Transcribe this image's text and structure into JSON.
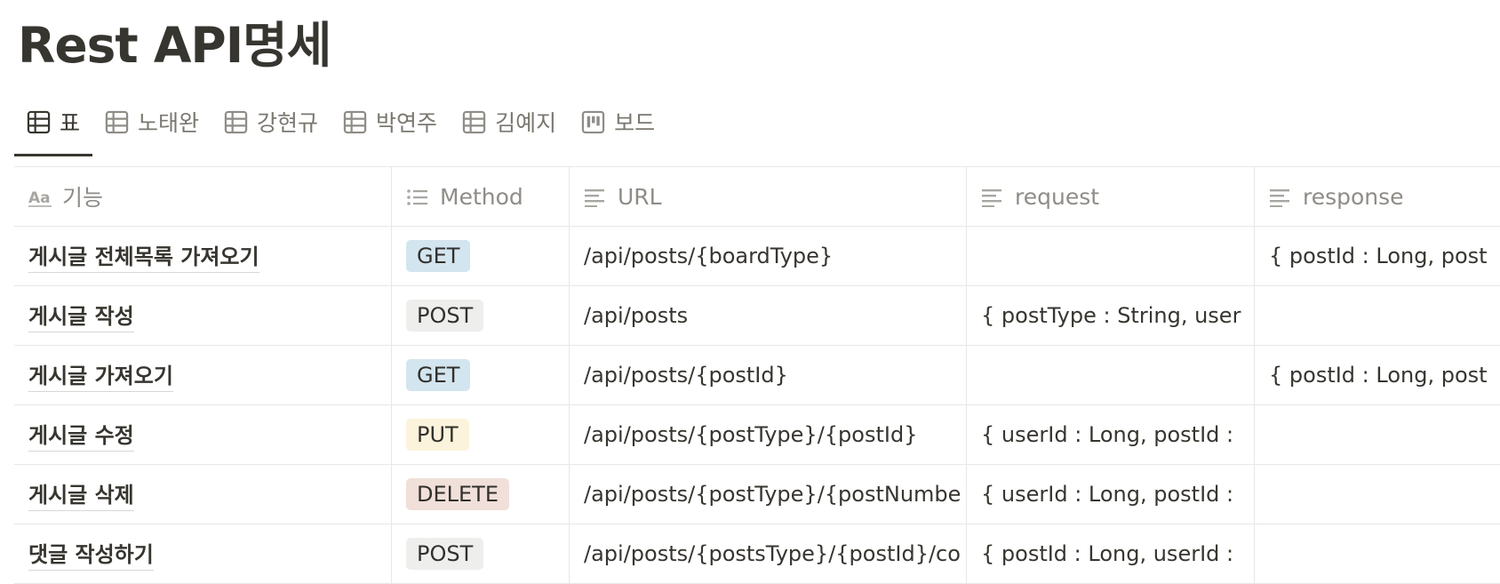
{
  "page": {
    "title": "Rest API명세"
  },
  "tabs": [
    {
      "label": "표",
      "icon": "table-icon",
      "active": true
    },
    {
      "label": "노태완",
      "icon": "table-icon",
      "active": false
    },
    {
      "label": "강현규",
      "icon": "table-icon",
      "active": false
    },
    {
      "label": "박연주",
      "icon": "table-icon",
      "active": false
    },
    {
      "label": "김예지",
      "icon": "table-icon",
      "active": false
    },
    {
      "label": "보드",
      "icon": "board-icon",
      "active": false
    }
  ],
  "table": {
    "columns": [
      {
        "label": "기능",
        "icon": "title-property-icon"
      },
      {
        "label": "Method",
        "icon": "list-property-icon"
      },
      {
        "label": "URL",
        "icon": "text-property-icon"
      },
      {
        "label": "request",
        "icon": "text-property-icon"
      },
      {
        "label": "response",
        "icon": "text-property-icon"
      }
    ],
    "rows": [
      {
        "name": "게시글 전체목록 가져오기",
        "method": "GET",
        "url": "/api/posts/{boardType}",
        "request": "",
        "response": "{ postId : Long, post"
      },
      {
        "name": "게시글 작성",
        "method": "POST",
        "url": "/api/posts",
        "request": "{ postType : String, user",
        "response": ""
      },
      {
        "name": "게시글 가져오기",
        "method": "GET",
        "url": "/api/posts/{postId}",
        "request": "",
        "response": "{ postId : Long, post"
      },
      {
        "name": "게시글 수정",
        "method": "PUT",
        "url": "/api/posts/{postType}/{postId}",
        "request": "{ userId : Long, postId :",
        "response": ""
      },
      {
        "name": "게시글 삭제",
        "method": "DELETE",
        "url": "/api/posts/{postType}/{postNumbe",
        "request": "{ userId : Long, postId :",
        "response": ""
      },
      {
        "name": "댓글 작성하기",
        "method": "POST",
        "url": "/api/posts/{postsType}/{postId}/co",
        "request": "{ postId : Long, userId :",
        "response": ""
      }
    ]
  },
  "method_colors": {
    "GET": "#d3e5ef",
    "POST": "#eeeeed",
    "PUT": "#fbf3db",
    "DELETE": "#f0e0d9"
  }
}
